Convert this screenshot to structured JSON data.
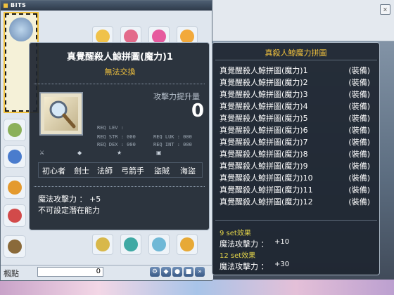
{
  "colors": {
    "accent": "#f2c23d",
    "tooltip_bg": "#1e2630",
    "set_effect": "#e5d64a"
  },
  "inventory": {
    "title": "BITS",
    "meso_label": "楓點",
    "meso_value": "0",
    "buttons": [
      "gear-icon",
      "shield-icon",
      "search-icon",
      "square-icon",
      "fast-forward-icon",
      "arrow-icon"
    ]
  },
  "tooltip": {
    "title": "真覺醒殺人鯨拼圖(魔力)1",
    "subtitle": "無法交換",
    "atk_label": "攻擊力提升量",
    "atk_value": "0",
    "req": {
      "lev": "REQ LEV :",
      "str": "REQ STR : 000",
      "dex": "REQ DEX : 000",
      "luk": "REQ LUK : 000",
      "int": "REQ INT : 000"
    },
    "classes": [
      "初心者",
      "劍士",
      "法師",
      "弓箭手",
      "盜賊",
      "海盜"
    ],
    "stat_line": "魔法攻擊力 ： +5",
    "potential_line": "不可設定潛在能力"
  },
  "set_tooltip": {
    "title": "真殺人鯨魔力拼圖",
    "items": [
      {
        "name": "真覺醒殺人鯨拼圖(魔力)1",
        "state": "(裝備)"
      },
      {
        "name": "真覺醒殺人鯨拼圖(魔力)2",
        "state": "(裝備)"
      },
      {
        "name": "真覺醒殺人鯨拼圖(魔力)3",
        "state": "(裝備)"
      },
      {
        "name": "真覺醒殺人鯨拼圖(魔力)4",
        "state": "(裝備)"
      },
      {
        "name": "真覺醒殺人鯨拼圖(魔力)5",
        "state": "(裝備)"
      },
      {
        "name": "真覺醒殺人鯨拼圖(魔力)6",
        "state": "(裝備)"
      },
      {
        "name": "真覺醒殺人鯨拼圖(魔力)7",
        "state": "(裝備)"
      },
      {
        "name": "真覺醒殺人鯨拼圖(魔力)8",
        "state": "(裝備)"
      },
      {
        "name": "真覺醒殺人鯨拼圖(魔力)9",
        "state": "(裝備)"
      },
      {
        "name": "真覺醒殺人鯨拼圖(魔力)10",
        "state": "(裝備)"
      },
      {
        "name": "真覺醒殺人鯨拼圖(魔力)11",
        "state": "(裝備)"
      },
      {
        "name": "真覺醒殺人鯨拼圖(魔力)12",
        "state": "(裝備)"
      }
    ],
    "effects": [
      {
        "header": "9 set效果",
        "label": "魔法攻擊力 ：",
        "value": "+10"
      },
      {
        "header": "12 set效果",
        "label": "魔法攻擊力 ：",
        "value": "+30"
      }
    ]
  }
}
